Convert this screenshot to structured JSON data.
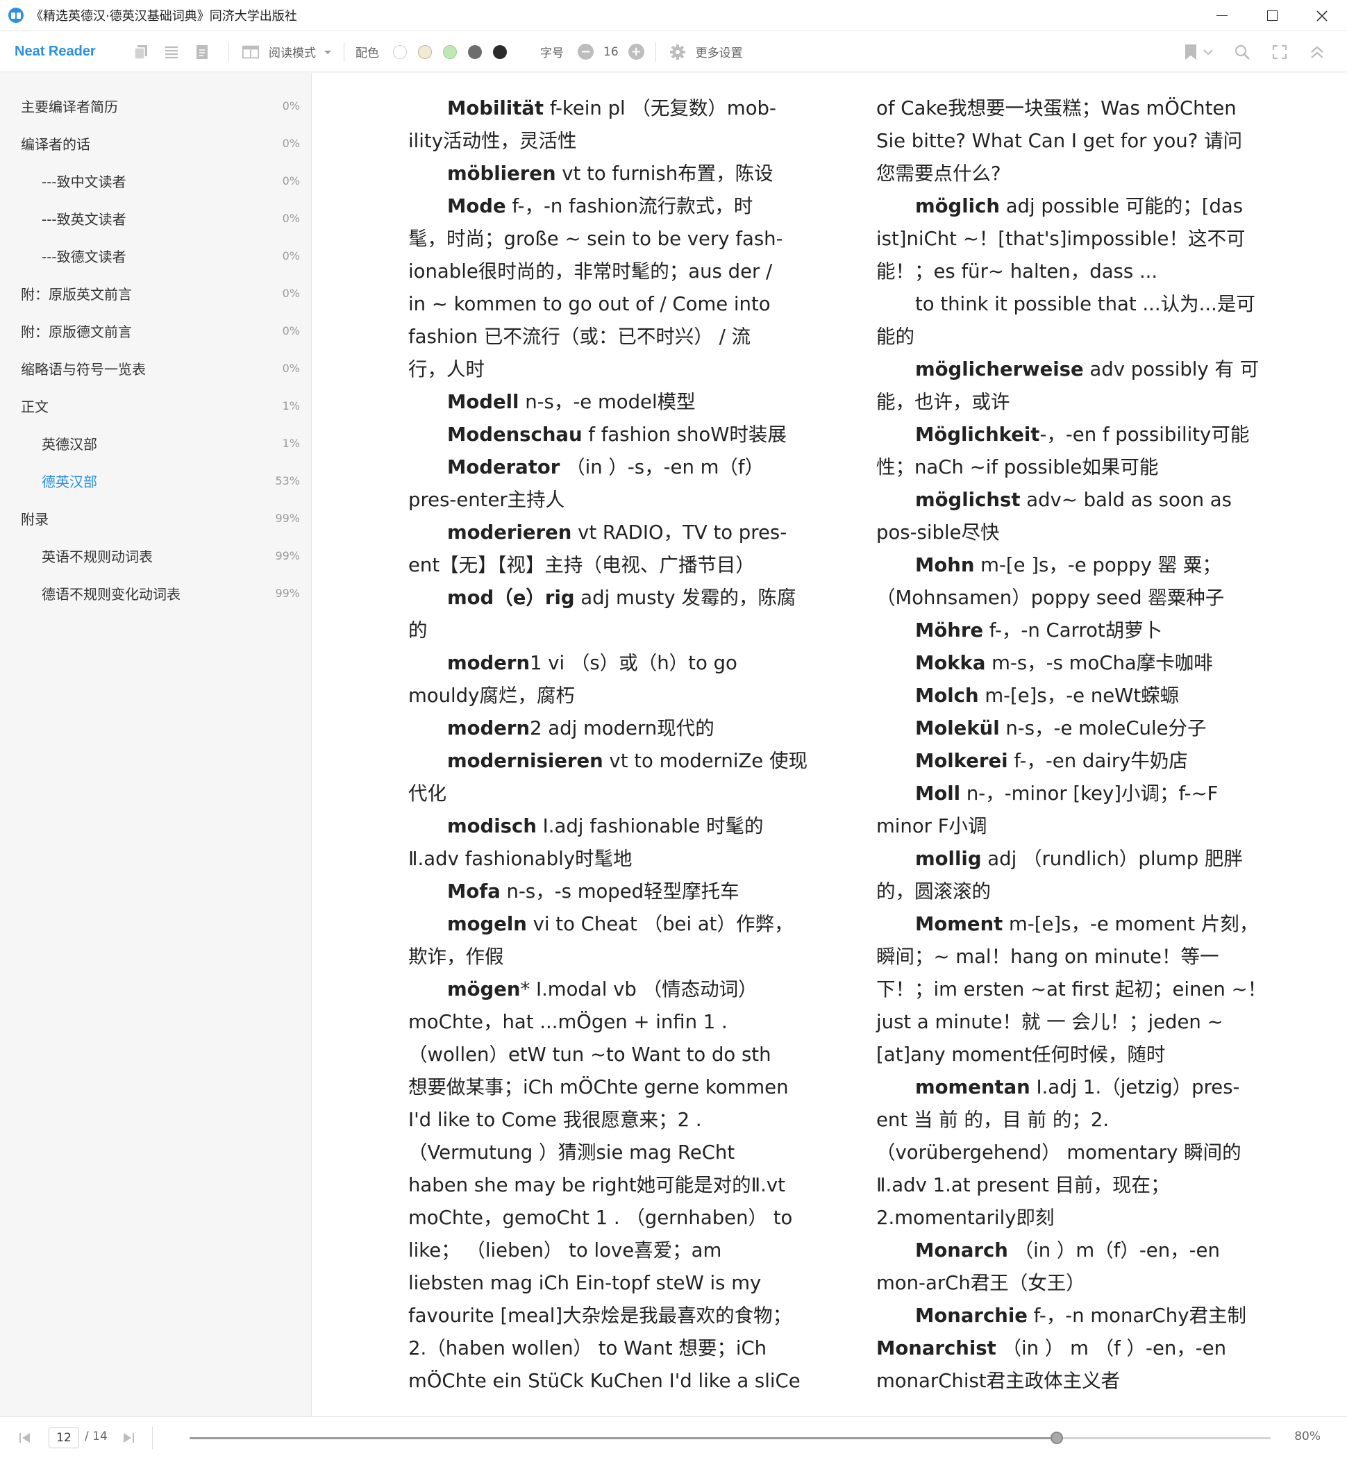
{
  "window": {
    "title": "《精选英德汉·德英汉基础词典》同济大学出版社"
  },
  "toolbar": {
    "brand": "Neat Reader",
    "read_mode_label": "阅读模式",
    "color_label": "配色",
    "font_size_label": "字号",
    "font_size_value": "16",
    "more_settings_label": "更多设置",
    "minus_glyph": "−",
    "plus_glyph": "+",
    "color_swatches": [
      "#ffffff",
      "#f3ead6",
      "#bfe8b5",
      "#6d6d6d",
      "#2b2b2b"
    ],
    "accent_color": "#2b8fe3"
  },
  "sidebar": {
    "items": [
      {
        "label": "主要编译者简历",
        "percent": "0%",
        "indent": false,
        "active": false
      },
      {
        "label": "编译者的话",
        "percent": "0%",
        "indent": false,
        "active": false
      },
      {
        "label": "---致中文读者",
        "percent": "0%",
        "indent": true,
        "active": false
      },
      {
        "label": "---致英文读者",
        "percent": "0%",
        "indent": true,
        "active": false
      },
      {
        "label": "---致德文读者",
        "percent": "0%",
        "indent": true,
        "active": false
      },
      {
        "label": "附：原版英文前言",
        "percent": "0%",
        "indent": false,
        "active": false
      },
      {
        "label": "附：原版德文前言",
        "percent": "0%",
        "indent": false,
        "active": false
      },
      {
        "label": "缩略语与符号一览表",
        "percent": "0%",
        "indent": false,
        "active": false
      },
      {
        "label": "正文",
        "percent": "1%",
        "indent": false,
        "active": false
      },
      {
        "label": "英德汉部",
        "percent": "1%",
        "indent": true,
        "active": false
      },
      {
        "label": "德英汉部",
        "percent": "53%",
        "indent": true,
        "active": true
      },
      {
        "label": "附录",
        "percent": "99%",
        "indent": false,
        "active": false
      },
      {
        "label": "英语不规则动词表",
        "percent": "99%",
        "indent": true,
        "active": false
      },
      {
        "label": "德语不规则变化动词表",
        "percent": "99%",
        "indent": true,
        "active": false
      }
    ]
  },
  "content": {
    "left": [
      {
        "first": true,
        "head": "Mobilität",
        "text": " f-kein pl （无复数）mob-"
      },
      {
        "first": false,
        "head": "",
        "text": "ility活动性，灵活性"
      },
      {
        "first": true,
        "head": "möblieren",
        "text": " vt to furnish布置，陈设"
      },
      {
        "first": true,
        "head": "Mode",
        "text": " f-，-n fashion流行款式，时"
      },
      {
        "first": false,
        "head": "",
        "text": "髦，时尚；große ~ sein to be very fash-"
      },
      {
        "first": false,
        "head": "",
        "text": "ionable很时尚的，非常时髦的；aus der /"
      },
      {
        "first": false,
        "head": "",
        "text": "in ~ kommen to go out of / Come into"
      },
      {
        "first": false,
        "head": "",
        "text": "fashion 已不流行（或：已不时兴） / 流"
      },
      {
        "first": false,
        "head": "",
        "text": "行，人时"
      },
      {
        "first": true,
        "head": "Modell",
        "text": " n-s，-e model模型"
      },
      {
        "first": true,
        "head": "Modenschau",
        "text": " f fashion shoW时装展"
      },
      {
        "first": true,
        "head": "Moderator",
        "text": " （in ）-s，-en m（f）"
      },
      {
        "first": false,
        "head": "",
        "text": "pres-enter主持人"
      },
      {
        "first": true,
        "head": "moderieren",
        "text": " vt RADIO，TV to pres-"
      },
      {
        "first": false,
        "head": "",
        "text": "ent【无】【视】主持（电视、广播节目）"
      },
      {
        "first": true,
        "head": "mod（e）rig",
        "text": " adj musty 发霉的，陈腐"
      },
      {
        "first": false,
        "head": "",
        "text": "的"
      },
      {
        "first": true,
        "head": "modern",
        "text": "1 vi （s）或（h）to go"
      },
      {
        "first": false,
        "head": "",
        "text": "mouldy腐烂，腐朽"
      },
      {
        "first": true,
        "head": "modern",
        "text": "2 adj modern现代的"
      },
      {
        "first": true,
        "head": "modernisieren",
        "text": " vt to moderniZe 使现"
      },
      {
        "first": false,
        "head": "",
        "text": "代化"
      },
      {
        "first": true,
        "head": "modisch",
        "text": " Ⅰ.adj fashionable 时髦的"
      },
      {
        "first": false,
        "head": "",
        "text": "Ⅱ.adv fashionably时髦地"
      },
      {
        "first": true,
        "head": "Mofa",
        "text": " n-s，-s moped轻型摩托车"
      },
      {
        "first": true,
        "head": "mogeln",
        "text": " vi to Cheat （bei at）作弊，"
      },
      {
        "first": false,
        "head": "",
        "text": "欺诈，作假"
      },
      {
        "first": true,
        "head": "mögen",
        "text": "* Ⅰ.modal vb （情态动词）"
      },
      {
        "first": false,
        "head": "",
        "text": "moChte，hat ...mÖgen + infin 1 ."
      },
      {
        "first": false,
        "head": "",
        "text": "（wollen）etW tun ~to Want to do sth"
      },
      {
        "first": false,
        "head": "",
        "text": "想要做某事；iCh mÖChte gerne kommen"
      },
      {
        "first": false,
        "head": "",
        "text": "I'd like to Come 我很愿意来；2 ."
      },
      {
        "first": false,
        "head": "",
        "text": "（Vermutung ）猜测sie mag ReCht"
      },
      {
        "first": false,
        "head": "",
        "text": "haben she may be right她可能是对的Ⅱ.vt"
      },
      {
        "first": false,
        "head": "",
        "text": "moChte，gemoCht 1 . （gernhaben） to"
      },
      {
        "first": false,
        "head": "",
        "text": "like； （lieben） to love喜爱；am"
      },
      {
        "first": false,
        "head": "",
        "text": "liebsten mag iCh Ein-topf steW is my"
      },
      {
        "first": false,
        "head": "",
        "text": "favourite [meal]大杂烩是我最喜欢的食物；"
      },
      {
        "first": false,
        "head": "",
        "text": "2.（haben wollen） to Want 想要；iCh"
      },
      {
        "first": false,
        "head": "",
        "text": "mÖChte ein StüCk KuChen I'd like a sliCe"
      }
    ],
    "right": [
      {
        "first": false,
        "head": "",
        "text": "of Cake我想要一块蛋糕；Was mÖChten"
      },
      {
        "first": false,
        "head": "",
        "text": "Sie bitte? What Can I get for you? 请问"
      },
      {
        "first": false,
        "head": "",
        "text": "您需要点什么?"
      },
      {
        "first": true,
        "head": "möglich",
        "text": " adj possible 可能的；[das"
      },
      {
        "first": false,
        "head": "",
        "text": "ist]niCht ~！[that's]impossible！这不可"
      },
      {
        "first": false,
        "head": "",
        "text": "能！；es für~ halten，dass ..."
      },
      {
        "first": true,
        "head": "",
        "text": "to think it possible that ...认为...是可"
      },
      {
        "first": false,
        "head": "",
        "text": "能的"
      },
      {
        "first": true,
        "head": "möglicherweise",
        "text": " adv possibly 有 可"
      },
      {
        "first": false,
        "head": "",
        "text": "能，也许，或许"
      },
      {
        "first": true,
        "head": "Möglichkeit",
        "text": "-，-en f possibility可能"
      },
      {
        "first": false,
        "head": "",
        "text": "性；naCh ~if possible如果可能"
      },
      {
        "first": true,
        "head": "möglichst",
        "text": " adv~ bald as soon as"
      },
      {
        "first": false,
        "head": "",
        "text": "pos-sible尽快"
      },
      {
        "first": true,
        "head": "Mohn",
        "text": " m-[e ]s，-e poppy 罂 粟；"
      },
      {
        "first": false,
        "head": "",
        "text": "（Mohnsamen）poppy seed 罂粟种子"
      },
      {
        "first": true,
        "head": "Möhre",
        "text": " f-，-n Carrot胡萝卜"
      },
      {
        "first": true,
        "head": "Mokka",
        "text": " m-s，-s moCha摩卡咖啡"
      },
      {
        "first": true,
        "head": "Molch",
        "text": " m-[e]s，-e neWt蝾螈"
      },
      {
        "first": true,
        "head": "Molekül",
        "text": " n-s，-e moleCule分子"
      },
      {
        "first": true,
        "head": "Molkerei",
        "text": " f-，-en dairy牛奶店"
      },
      {
        "first": true,
        "head": "Moll",
        "text": " n-，-minor [key]小调；f-~F"
      },
      {
        "first": false,
        "head": "",
        "text": "minor F小调"
      },
      {
        "first": true,
        "head": "mollig",
        "text": " adj （rundlich）plump 肥胖"
      },
      {
        "first": false,
        "head": "",
        "text": "的，圆滚滚的"
      },
      {
        "first": true,
        "head": "Moment",
        "text": " m-[e]s，-e moment 片刻，"
      },
      {
        "first": false,
        "head": "",
        "text": "瞬间；~ mal！hang on minute！等一"
      },
      {
        "first": false,
        "head": "",
        "text": "下！；im ersten ~at first 起初；einen ~！"
      },
      {
        "first": false,
        "head": "",
        "text": "just a minute！就 一 会儿！；jeden ~"
      },
      {
        "first": false,
        "head": "",
        "text": "[at]any moment任何时候，随时"
      },
      {
        "first": true,
        "head": "momentan",
        "text": " Ⅰ.adj 1.（jetzig）pres-"
      },
      {
        "first": false,
        "head": "",
        "text": "ent 当 前 的，目 前 的；2."
      },
      {
        "first": false,
        "head": "",
        "text": "（vorübergehend） momentary 瞬间的"
      },
      {
        "first": false,
        "head": "",
        "text": "Ⅱ.adv 1.at present 目前，现在；"
      },
      {
        "first": false,
        "head": "",
        "text": "2.momentarily即刻"
      },
      {
        "first": true,
        "head": "Monarch",
        "text": " （in ）m（f）-en，-en"
      },
      {
        "first": false,
        "head": "",
        "text": "mon-arCh君王（女王）"
      },
      {
        "first": true,
        "head": "Monarchie",
        "text": " f-，-n monarChy君主制"
      },
      {
        "first": false,
        "head": "Monarchist",
        "text": " （in ） m （f ）-en，-en"
      },
      {
        "first": false,
        "head": "",
        "text": "monarChist君主政体主义者"
      }
    ]
  },
  "footer": {
    "current_page": "12",
    "total_pages": "/ 14",
    "progress": 0.802,
    "zoom": "80%"
  }
}
